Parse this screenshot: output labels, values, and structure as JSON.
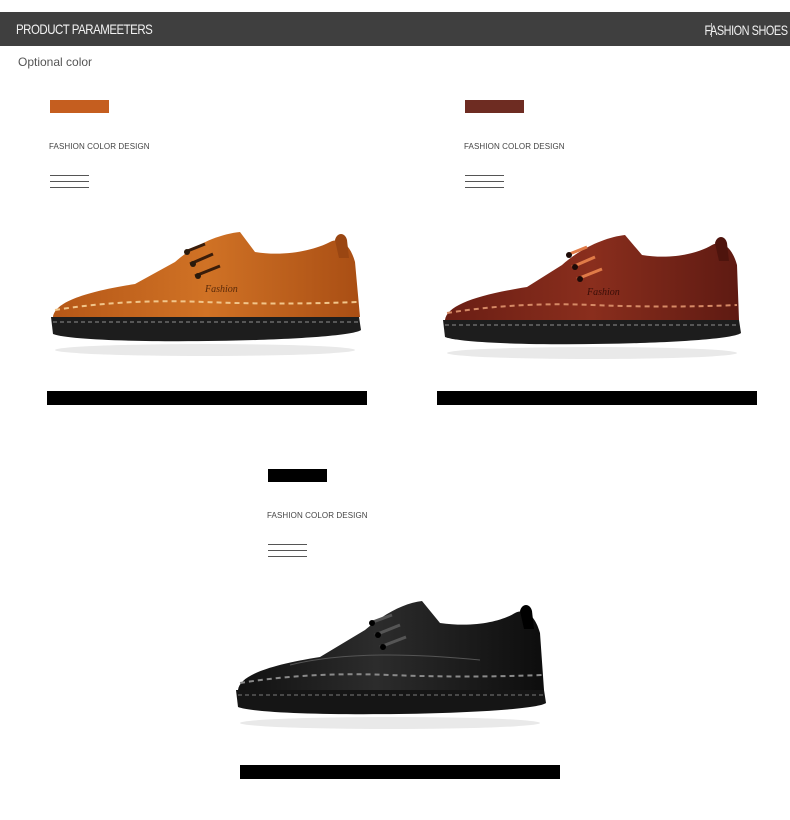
{
  "header": {
    "title": "PRODUCT PARAMEETERS",
    "right_label": "FASHION SHOES"
  },
  "subtitle": "Optional color",
  "variants": [
    {
      "color_name": "brown",
      "swatch_color": "#c55e1f",
      "upper_color": "#c1621e",
      "shade_color": "#7c3510",
      "design_label": "FASHION COLOR DESIGN"
    },
    {
      "color_name": "dark brown",
      "swatch_color": "#6e2c22",
      "upper_color": "#7a2418",
      "shade_color": "#3a0f09",
      "design_label": "FASHION COLOR DESIGN"
    },
    {
      "color_name": "black",
      "swatch_color": "#000000",
      "upper_color": "#1b1b1b",
      "shade_color": "#000000",
      "design_label": "FASHION COLOR DESIGN"
    }
  ],
  "colors": {
    "header_bg": "#3f3f3f",
    "name_bar": "#000000"
  }
}
